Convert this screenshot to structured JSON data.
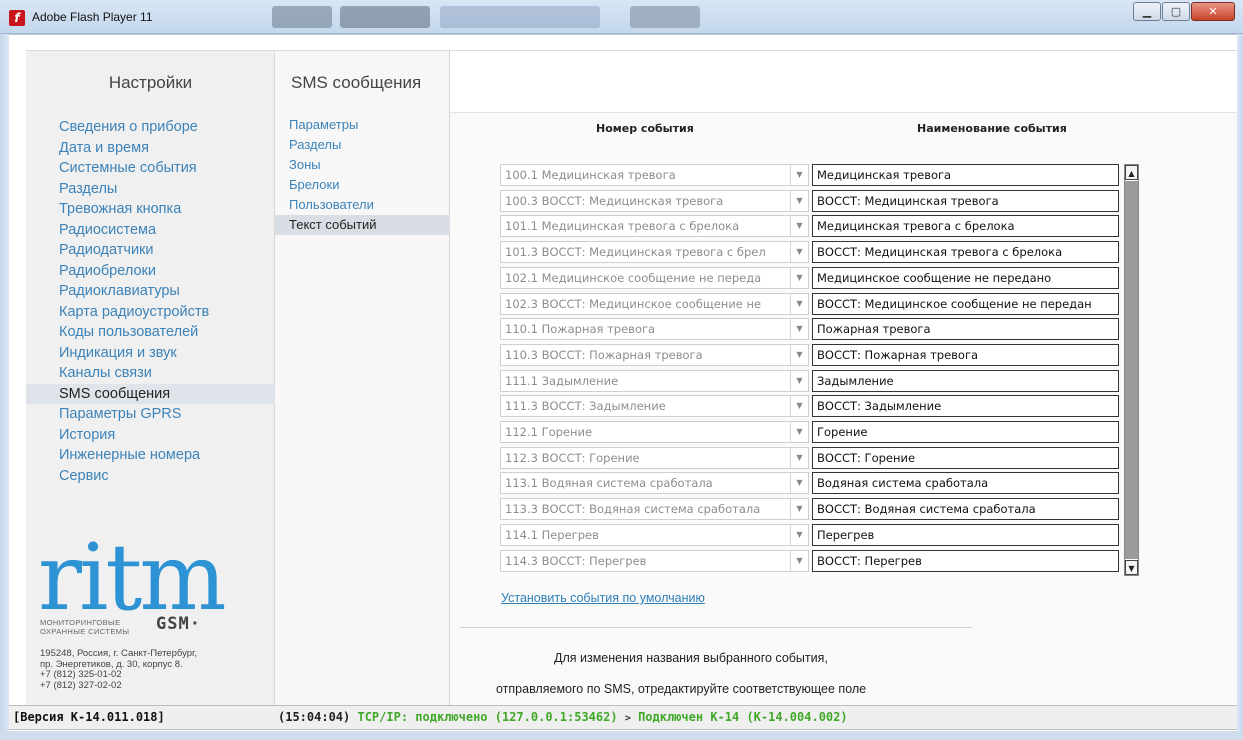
{
  "window": {
    "title": "Adobe Flash Player 11",
    "icon": "flash-icon",
    "buttons": {
      "minimize": "▁",
      "maximize": "▢",
      "close": "✕"
    }
  },
  "left_panel": {
    "heading": "Настройки",
    "items": [
      "Сведения о приборе",
      "Дата и время",
      "Системные события",
      "Разделы",
      "Тревожная кнопка",
      "Радиосистема",
      "Радиодатчики",
      "Радиобрелоки",
      "Радиоклавиатуры",
      "Карта радиоустройств",
      "Коды пользователей",
      "Индикация и звук",
      "Каналы связи",
      "SMS сообщения",
      "Параметры GPRS",
      "История",
      "Инженерные номера",
      "Сервис"
    ],
    "active_index": 13,
    "logo": {
      "main": "ritm",
      "sub1": "МОНИТОРИНГОВЫЕ",
      "sub2": "ОХРАННЫЕ СИСТЕМЫ",
      "gsm": "GSM·"
    },
    "address": [
      "195248, Россия, г. Санкт-Петербург,",
      "пр. Энергетиков, д. 30, корпус 8.",
      "+7 (812) 325-01-02",
      "+7 (812) 327-02-02"
    ]
  },
  "mid_panel": {
    "heading": "SMS сообщения",
    "items": [
      "Параметры",
      "Разделы",
      "Зоны",
      "Брелоки",
      "Пользователи",
      "Текст событий"
    ],
    "active_index": 5
  },
  "content": {
    "col_event_number": "Номер события",
    "col_event_name": "Наименование события",
    "rows": [
      {
        "code": "100.1 Медицинская тревога",
        "name": "Медицинская тревога"
      },
      {
        "code": "100.3 ВОССТ: Медицинская тревога",
        "name": "ВОССТ: Медицинская тревога"
      },
      {
        "code": "101.1 Медицинская тревога с брелока",
        "name": "Медицинская тревога с брелока"
      },
      {
        "code": "101.3 ВОССТ: Медицинская тревога с брел",
        "name": "ВОССТ: Медицинская тревога с брелока"
      },
      {
        "code": "102.1 Медицинское сообщение не переда",
        "name": "Медицинское сообщение не передано"
      },
      {
        "code": "102.3 ВОССТ: Медицинское сообщение не",
        "name": "ВОССТ: Медицинское сообщение не передан"
      },
      {
        "code": "110.1 Пожарная тревога",
        "name": "Пожарная тревога"
      },
      {
        "code": "110.3 ВОССТ: Пожарная тревога",
        "name": "ВОССТ: Пожарная тревога"
      },
      {
        "code": "111.1 Задымление",
        "name": "Задымление"
      },
      {
        "code": "111.3 ВОССТ: Задымление",
        "name": "ВОССТ: Задымление"
      },
      {
        "code": "112.1 Горение",
        "name": "Горение"
      },
      {
        "code": "112.3 ВОССТ: Горение",
        "name": "ВОССТ: Горение"
      },
      {
        "code": "113.1 Водяная система сработала",
        "name": "Водяная система сработала"
      },
      {
        "code": "113.3 ВОССТ: Водяная система сработала",
        "name": "ВОССТ: Водяная система сработала"
      },
      {
        "code": "114.1 Перегрев",
        "name": "Перегрев"
      },
      {
        "code": "114.3 ВОССТ: Перегрев",
        "name": "ВОССТ: Перегрев"
      }
    ],
    "default_link": "Установить события по умолчанию",
    "hint_line1": "Для изменения названия выбранного события,",
    "hint_line2": "отправляемого по SMS, отредактируйте соответствующее поле"
  },
  "status": {
    "version": "[Версия К-14.011.018]",
    "time": "(15:04:04)",
    "connection": "TCP/IP: подключено (127.0.0.1:53462)",
    "arrow": ">",
    "device": "Подключен К-14 (К-14.004.002)"
  },
  "colors": {
    "link": "#3c83b9",
    "status_ok": "#40a828",
    "logo": "#2e93d4"
  }
}
